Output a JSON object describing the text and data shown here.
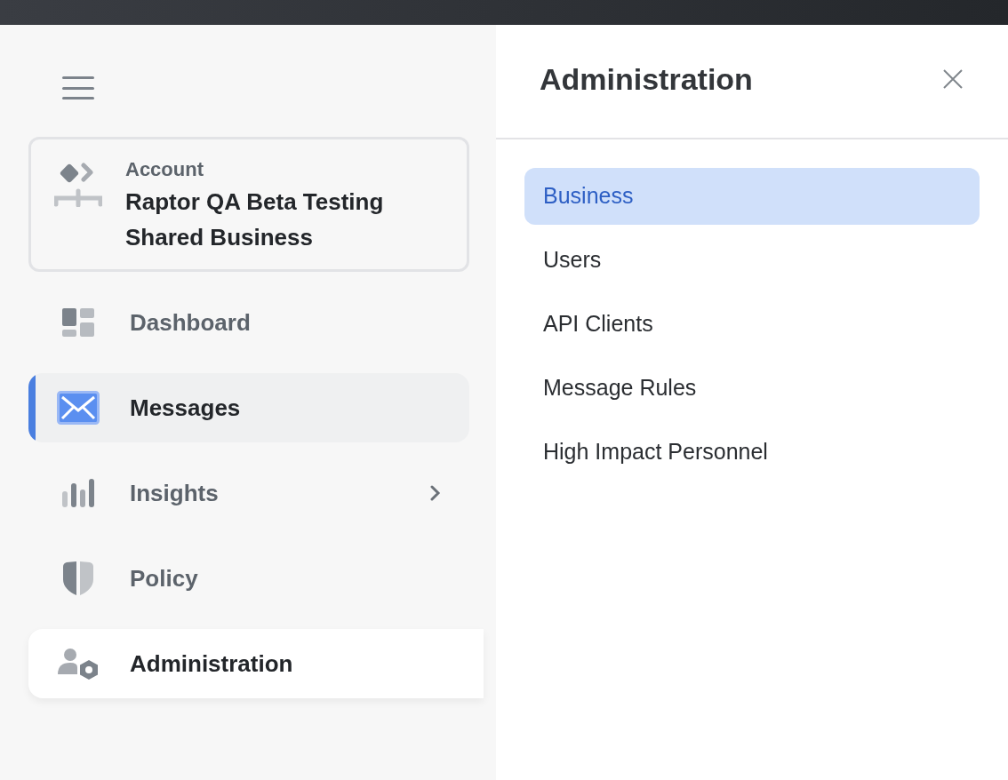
{
  "account": {
    "label": "Account",
    "name": "Raptor QA Beta Testing Shared Business"
  },
  "nav": [
    {
      "kind": "dashboard",
      "label": "Dashboard",
      "selected": false,
      "open": false,
      "has_submenu": false
    },
    {
      "kind": "messages",
      "label": "Messages",
      "selected": true,
      "open": false,
      "has_submenu": false
    },
    {
      "kind": "insights",
      "label": "Insights",
      "selected": false,
      "open": false,
      "has_submenu": true
    },
    {
      "kind": "policy",
      "label": "Policy",
      "selected": false,
      "open": false,
      "has_submenu": false
    },
    {
      "kind": "administration",
      "label": "Administration",
      "selected": false,
      "open": true,
      "has_submenu": false
    }
  ],
  "panel": {
    "title": "Administration",
    "items": [
      {
        "label": "Business",
        "selected": true
      },
      {
        "label": "Users",
        "selected": false
      },
      {
        "label": "API Clients",
        "selected": false
      },
      {
        "label": "Message Rules",
        "selected": false
      },
      {
        "label": "High Impact Personnel",
        "selected": false
      }
    ]
  }
}
